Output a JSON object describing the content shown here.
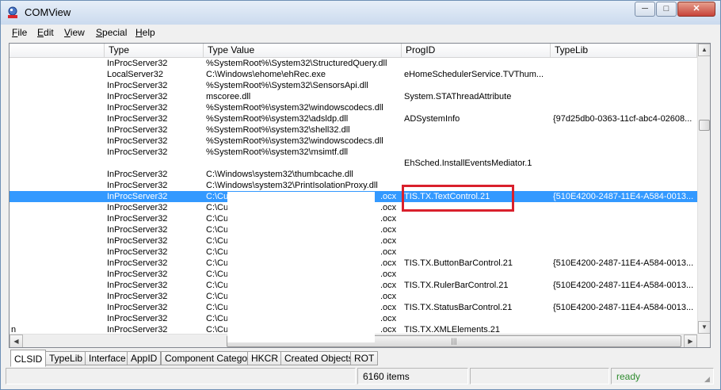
{
  "window": {
    "title": "COMView"
  },
  "controls": {
    "minimize": "─",
    "maximize": "□",
    "close": "✕"
  },
  "menu": [
    {
      "key": "F",
      "rest": "ile"
    },
    {
      "key": "E",
      "rest": "dit"
    },
    {
      "key": "V",
      "rest": "iew"
    },
    {
      "key": "S",
      "rest": "pecial"
    },
    {
      "key": "H",
      "rest": "elp"
    }
  ],
  "columns": [
    "",
    "Type",
    "Type Value",
    "ProgID",
    "TypeLib"
  ],
  "rows": [
    {
      "c0": "",
      "type": "InProcServer32",
      "value": "%SystemRoot%\\System32\\StructuredQuery.dll",
      "progid": "",
      "typelib": ""
    },
    {
      "c0": "",
      "type": "LocalServer32",
      "value": "C:\\Windows\\ehome\\ehRec.exe",
      "progid": "eHomeSchedulerService.TVThum...",
      "typelib": ""
    },
    {
      "c0": "",
      "type": "InProcServer32",
      "value": "%SystemRoot%\\System32\\SensorsApi.dll",
      "progid": "",
      "typelib": ""
    },
    {
      "c0": "",
      "type": "InProcServer32",
      "value": "mscoree.dll",
      "progid": "System.STAThreadAttribute",
      "typelib": ""
    },
    {
      "c0": "",
      "type": "InProcServer32",
      "value": "%SystemRoot%\\system32\\windowscodecs.dll",
      "progid": "",
      "typelib": ""
    },
    {
      "c0": "",
      "type": "InProcServer32",
      "value": "%SystemRoot%\\system32\\adsldp.dll",
      "progid": "ADSystemInfo",
      "typelib": "{97d25db0-0363-11cf-abc4-02608..."
    },
    {
      "c0": "",
      "type": "InProcServer32",
      "value": "%SystemRoot%\\system32\\shell32.dll",
      "progid": "",
      "typelib": ""
    },
    {
      "c0": "",
      "type": "InProcServer32",
      "value": "%SystemRoot%\\system32\\windowscodecs.dll",
      "progid": "",
      "typelib": ""
    },
    {
      "c0": "",
      "type": "InProcServer32",
      "value": "%SystemRoot%\\system32\\msimtf.dll",
      "progid": "",
      "typelib": ""
    },
    {
      "c0": "",
      "type": "",
      "value": "",
      "progid": "EhSched.InstallEventsMediator.1",
      "typelib": ""
    },
    {
      "c0": "",
      "type": "InProcServer32",
      "value": "C:\\Windows\\system32\\thumbcache.dll",
      "progid": "",
      "typelib": ""
    },
    {
      "c0": "",
      "type": "InProcServer32",
      "value": "C:\\Windows\\system32\\PrintIsolationProxy.dll",
      "progid": "",
      "typelib": ""
    },
    {
      "c0": "",
      "type": "InProcServer32",
      "value": "C:\\Cu...ocx",
      "value_l": "C:\\Cu",
      "value_r": ".ocx",
      "progid": "TIS.TX.TextControl.21",
      "typelib": "{510E4200-2487-11E4-A584-0013...",
      "selected": true
    },
    {
      "c0": "",
      "type": "InProcServer32",
      "value_l": "C:\\Cu",
      "value_r": ".ocx",
      "progid": "",
      "typelib": ""
    },
    {
      "c0": "",
      "type": "InProcServer32",
      "value_l": "C:\\Cu",
      "value_r": ".ocx",
      "progid": "",
      "typelib": ""
    },
    {
      "c0": "",
      "type": "InProcServer32",
      "value_l": "C:\\Cu",
      "value_r": ".ocx",
      "progid": "",
      "typelib": ""
    },
    {
      "c0": "",
      "type": "InProcServer32",
      "value_l": "C:\\Cu",
      "value_r": ".ocx",
      "progid": "",
      "typelib": ""
    },
    {
      "c0": "",
      "type": "InProcServer32",
      "value_l": "C:\\Cu",
      "value_r": ".ocx",
      "progid": "",
      "typelib": ""
    },
    {
      "c0": "",
      "type": "InProcServer32",
      "value_l": "C:\\Cu",
      "value_r": ".ocx",
      "progid": "TIS.TX.ButtonBarControl.21",
      "typelib": "{510E4200-2487-11E4-A584-0013..."
    },
    {
      "c0": "",
      "type": "InProcServer32",
      "value_l": "C:\\Cu",
      "value_r": ".ocx",
      "progid": "",
      "typelib": ""
    },
    {
      "c0": "",
      "type": "InProcServer32",
      "value_l": "C:\\Cu",
      "value_r": ".ocx",
      "progid": "TIS.TX.RulerBarControl.21",
      "typelib": "{510E4200-2487-11E4-A584-0013..."
    },
    {
      "c0": "",
      "type": "InProcServer32",
      "value_l": "C:\\Cu",
      "value_r": ".ocx",
      "progid": "",
      "typelib": ""
    },
    {
      "c0": "",
      "type": "InProcServer32",
      "value_l": "C:\\Cu",
      "value_r": ".ocx",
      "progid": "TIS.TX.StatusBarControl.21",
      "typelib": "{510E4200-2487-11E4-A584-0013..."
    },
    {
      "c0": "",
      "type": "InProcServer32",
      "value_l": "C:\\Cu",
      "value_r": ".ocx",
      "progid": "",
      "typelib": ""
    },
    {
      "c0": "n",
      "type": "InProcServer32",
      "value_l": "C:\\Cu",
      "value_r": ".ocx",
      "progid": "TIS.TX.XMLElements.21",
      "typelib": ""
    }
  ],
  "tabs": [
    "CLSID",
    "TypeLib",
    "Interface",
    "AppID",
    "Component Category",
    "HKCR",
    "Created Objects",
    "ROT"
  ],
  "active_tab": "CLSID",
  "status": {
    "left": "",
    "count": "6160 items",
    "middle": "",
    "state": "ready"
  },
  "colors": {
    "selection": "#3399ff",
    "highlight_box": "#d9202c",
    "ready_text": "#2e8b2e"
  },
  "icons": {
    "app": "comview-app-icon",
    "sort": "chevron-up-icon",
    "grip": "resize-grip-icon"
  }
}
